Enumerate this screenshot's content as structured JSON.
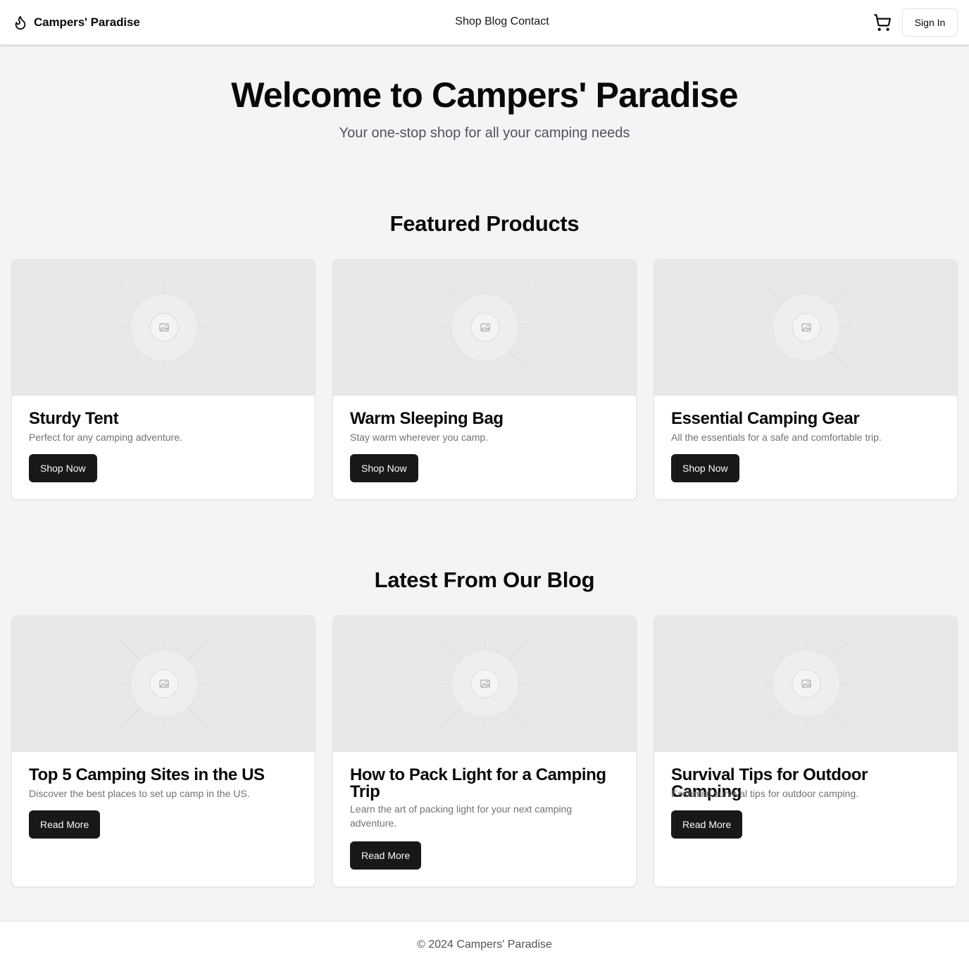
{
  "header": {
    "brand": "Campers' Paradise",
    "brand_icon": "flame-icon",
    "nav": [
      "Shop",
      "Blog",
      "Contact"
    ],
    "cart_icon": "shopping-cart-icon",
    "signin_label": "Sign In"
  },
  "hero": {
    "title": "Welcome to Campers' Paradise",
    "subtitle": "Your one-stop shop for all your camping needs"
  },
  "featured": {
    "title": "Featured Products",
    "items": [
      {
        "title": "Sturdy Tent",
        "desc": "Perfect for any camping adventure.",
        "button": "Shop Now"
      },
      {
        "title": "Warm Sleeping Bag",
        "desc": "Stay warm wherever you camp.",
        "button": "Shop Now"
      },
      {
        "title": "Essential Camping Gear",
        "desc": "All the essentials for a safe and comfortable trip.",
        "button": "Shop Now"
      }
    ]
  },
  "blog": {
    "title": "Latest From Our Blog",
    "items": [
      {
        "title": "Top 5 Camping Sites in the US",
        "desc": "Discover the best places to set up camp in the US.",
        "button": "Read More"
      },
      {
        "title": "How to Pack Light for a Camping Trip",
        "desc": "Learn the art of packing light for your next camping adventure.",
        "button": "Read More"
      },
      {
        "title": "Survival Tips for Outdoor Camping",
        "desc": "Essential survival tips for outdoor camping.",
        "button": "Read More"
      }
    ]
  },
  "footer": {
    "text": "© 2024 Campers' Paradise"
  },
  "colors": {
    "page_bg": "#f3f4f6",
    "button_bg": "#18181b",
    "placeholder_bg": "#e8e8e8"
  }
}
